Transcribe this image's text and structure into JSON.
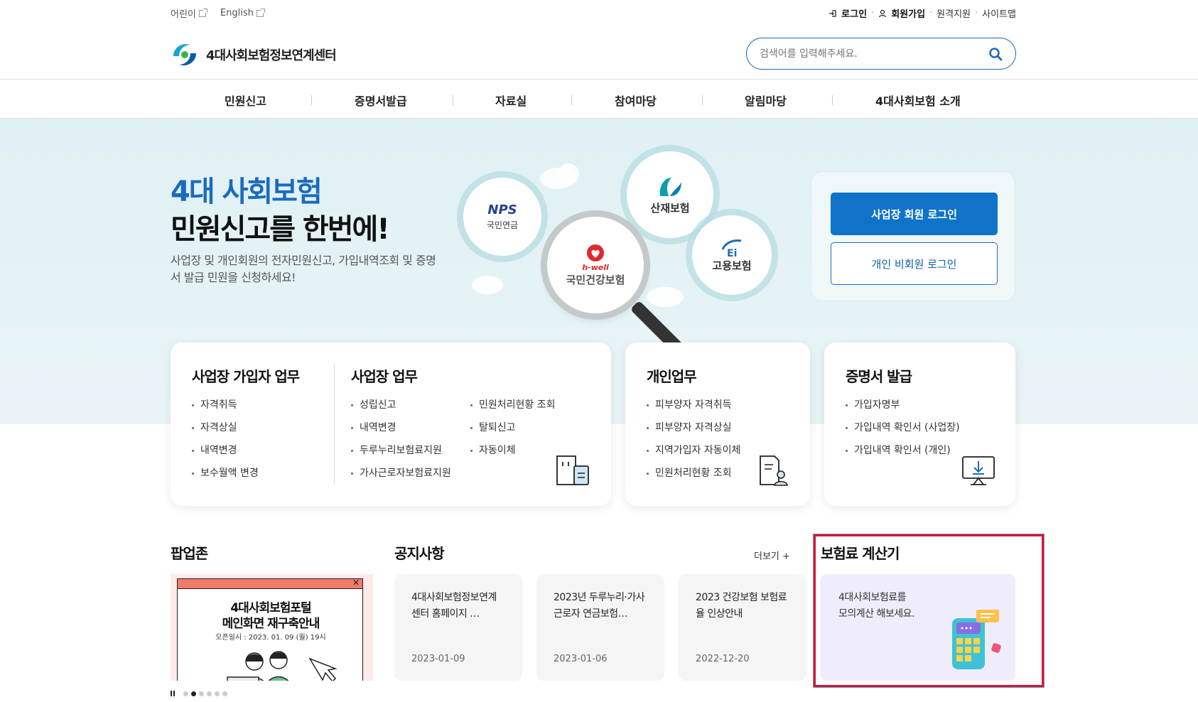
{
  "utility": {
    "kids": "어린이",
    "english": "English",
    "login": "로그인",
    "signup": "회원가입",
    "remote": "원격지원",
    "sitemap": "사이트맵"
  },
  "logo": {
    "text": "4대사회보험정보연계센터"
  },
  "search": {
    "placeholder": "검색어를 입력해주세요."
  },
  "nav": [
    "민원신고",
    "증명서발급",
    "자료실",
    "참여마당",
    "알림마당",
    "4대사회보험 소개"
  ],
  "hero": {
    "title1": "4대 사회보험",
    "title2": "민원신고를 한번에!",
    "desc": "사업장 및 개인회원의 전자민원신고, 가입내역조회 및 증명서 발급 민원을 신청하세요!",
    "insurers": {
      "nps_brand": "NPS",
      "nps": "국민연금",
      "health_brand": "h-well",
      "health": "국민건강보험",
      "comp": "산재보험",
      "employ": "고용보험"
    },
    "biz_login": "사업장 회원 로그인",
    "personal_login": "개인 비회원 로그인"
  },
  "cards": {
    "biz_sub": {
      "title": "사업장 가입자 업무",
      "items": [
        "자격취득",
        "자격상실",
        "내역변경",
        "보수월액 변경"
      ]
    },
    "biz": {
      "title": "사업장 업무",
      "col1": [
        "성립신고",
        "내역변경",
        "두루누리보험료지원",
        "가사근로자보험료지원"
      ],
      "col2": [
        "민원처리현황 조회",
        "탈퇴신고",
        "자동이체"
      ]
    },
    "personal": {
      "title": "개인업무",
      "items": [
        "피부양자 자격취득",
        "피부양자 자격상실",
        "지역가입자 자동이체",
        "민원처리현황 조회"
      ]
    },
    "cert": {
      "title": "증명서 발급",
      "items": [
        "가입자명부",
        "가입내역 확인서 (사업장)",
        "가입내역 확인서 (개인)"
      ]
    }
  },
  "popup": {
    "title": "팝업존",
    "line1": "4대사회보험포털",
    "line2": "메인화면 재구축안내",
    "line3": "오픈일시 : 2023. 01. 09 (월) 19시",
    "slide_count": 6,
    "active_slide": 1
  },
  "notices": {
    "title": "공지사항",
    "more": "더보기 +",
    "items": [
      {
        "title": "4대사회보험정보연계센터 홈페이지 …",
        "date": "2023-01-09"
      },
      {
        "title": "2023년 두루누리·가사근로자 연금보험…",
        "date": "2023-01-06"
      },
      {
        "title": "2023 건강보험 보험료율 인상안내",
        "date": "2022-12-20"
      }
    ]
  },
  "calculator": {
    "title": "보험료 계산기",
    "text1": "4대사회보험료를",
    "text2": "모의계산 해보세요."
  },
  "colors": {
    "primary": "#0f74c7",
    "accent_title": "#1a6bbf",
    "highlight": "#d7172f"
  }
}
